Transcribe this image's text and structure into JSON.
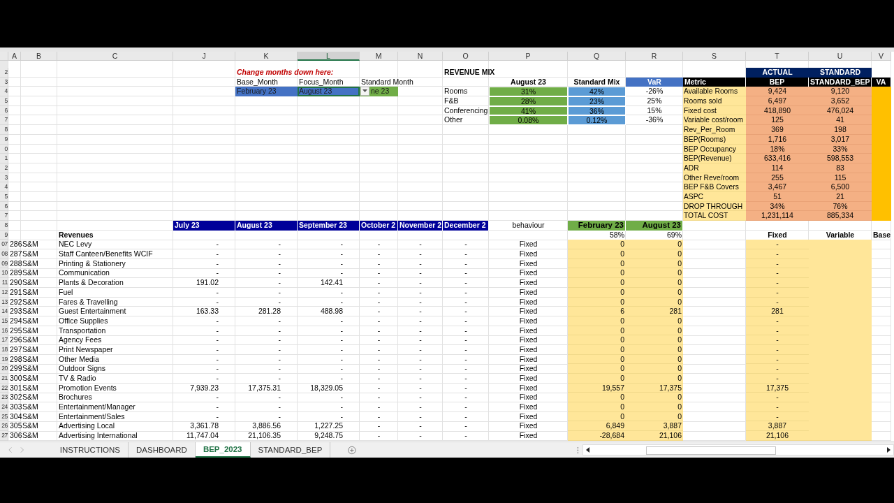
{
  "column_headers": [
    {
      "label": "A",
      "selected": false
    },
    {
      "label": "B",
      "selected": false
    },
    {
      "label": "C",
      "selected": false
    },
    {
      "label": "J",
      "selected": false
    },
    {
      "label": "K",
      "selected": false
    },
    {
      "label": "L",
      "selected": true
    },
    {
      "label": "M",
      "selected": false
    },
    {
      "label": "N",
      "selected": false
    },
    {
      "label": "O",
      "selected": false
    },
    {
      "label": "P",
      "selected": false
    },
    {
      "label": "Q",
      "selected": false
    },
    {
      "label": "R",
      "selected": false
    },
    {
      "label": "S",
      "selected": false
    },
    {
      "label": "T",
      "selected": false
    },
    {
      "label": "U",
      "selected": false
    },
    {
      "label": "V",
      "selected": false
    }
  ],
  "row_headers": [
    "2",
    "3",
    "4",
    "5",
    "6",
    "7",
    "8",
    "9",
    "0",
    "1",
    "2",
    "3",
    "4",
    "5",
    "6",
    "7",
    "8",
    "9",
    "07",
    "08",
    "09",
    "10",
    "11",
    "12",
    "13",
    "14",
    "15",
    "16",
    "17",
    "18",
    "19",
    "20",
    "21",
    "22",
    "23",
    "24",
    "25",
    "26",
    "27"
  ],
  "month_selector": {
    "title": "Change months down here:",
    "fields": [
      {
        "label": "Base_Month",
        "value": "February 23",
        "selected": false,
        "color": "#4472c4"
      },
      {
        "label": "Focus_Month",
        "value": "August 23",
        "selected": true,
        "color": "#4472c4"
      },
      {
        "label": "Standard Month",
        "value": "ne 23",
        "selected": false,
        "color": "#70ad47"
      }
    ]
  },
  "revenue_mix": {
    "title": "REVENUE MIX",
    "columns": [
      "August 23",
      "Standard Mix",
      "VaR"
    ],
    "rows": [
      {
        "label": "Rooms",
        "values": [
          "31%",
          "42%",
          "-26%"
        ]
      },
      {
        "label": "F&B",
        "values": [
          "28%",
          "23%",
          "25%"
        ]
      },
      {
        "label": "Conferencing",
        "values": [
          "41%",
          "36%",
          "15%"
        ]
      },
      {
        "label": "Other",
        "values": [
          "0.08%",
          "0.12%",
          "-36%"
        ]
      }
    ]
  },
  "metrics": {
    "group_headers": [
      "ACTUAL",
      "STANDARD"
    ],
    "columns": [
      "Metric",
      "BEP",
      "STANDARD_BEP",
      "VA"
    ],
    "rows": [
      {
        "label": "Available Rooms",
        "values": [
          "9,424",
          "9,120"
        ]
      },
      {
        "label": "Rooms sold",
        "values": [
          "6,497",
          "3,652"
        ]
      },
      {
        "label": "Fixed cost",
        "values": [
          "418,890",
          "476,024"
        ]
      },
      {
        "label": "Variable cost/room",
        "values": [
          "125",
          "41"
        ]
      },
      {
        "label": "Rev_Per_Room",
        "values": [
          "369",
          "198"
        ]
      },
      {
        "label": "BEP(Rooms)",
        "values": [
          "1,716",
          "3,017"
        ]
      },
      {
        "label": "BEP Occupancy",
        "values": [
          "18%",
          "33%"
        ]
      },
      {
        "label": "BEP(Revenue)",
        "values": [
          "633,416",
          "598,553"
        ]
      },
      {
        "label": "ADR",
        "values": [
          "114",
          "83"
        ]
      },
      {
        "label": "Other Reve/room",
        "values": [
          "255",
          "115"
        ]
      },
      {
        "label": "BEP F&B Covers",
        "values": [
          "3,467",
          "6,500"
        ]
      },
      {
        "label": "ASPC",
        "values": [
          "51",
          "21"
        ]
      },
      {
        "label": "DROP THROUGH",
        "values": [
          "34%",
          "76%"
        ]
      },
      {
        "label": "TOTAL COST",
        "values": [
          "1,231,114",
          "885,334"
        ]
      }
    ]
  },
  "cost_table": {
    "month_columns": [
      "July 23",
      "August 23",
      "September 23",
      "October 2",
      "November 2",
      "December 2"
    ],
    "behaviour_header": "behaviour",
    "compare_columns": [
      "February 23",
      "August 23"
    ],
    "section_label": "Revenues",
    "compare_ratios": [
      "58%",
      "69%"
    ],
    "split_columns": [
      "Fixed",
      "Variable",
      "Base"
    ],
    "rows": [
      {
        "code": "286",
        "dept": "S&M",
        "name": "NEC Levy",
        "months": [
          "-",
          "-",
          "-",
          "-",
          "-",
          "-"
        ],
        "behaviour": "Fixed",
        "compare": [
          "0",
          "0"
        ],
        "fixed": "-"
      },
      {
        "code": "287",
        "dept": "S&M",
        "name": "Staff Canteen/Benefits WCIF",
        "months": [
          "-",
          "-",
          "-",
          "-",
          "-",
          "-"
        ],
        "behaviour": "Fixed",
        "compare": [
          "0",
          "0"
        ],
        "fixed": "-"
      },
      {
        "code": "288",
        "dept": "S&M",
        "name": "Printing & Stationery",
        "months": [
          "-",
          "-",
          "-",
          "-",
          "-",
          "-"
        ],
        "behaviour": "Fixed",
        "compare": [
          "0",
          "0"
        ],
        "fixed": "-"
      },
      {
        "code": "289",
        "dept": "S&M",
        "name": "Communication",
        "months": [
          "-",
          "-",
          "-",
          "-",
          "-",
          "-"
        ],
        "behaviour": "Fixed",
        "compare": [
          "0",
          "0"
        ],
        "fixed": "-"
      },
      {
        "code": "290",
        "dept": "S&M",
        "name": "Plants & Decoration",
        "months": [
          "191.02",
          "-",
          "142.41",
          "-",
          "-",
          "-"
        ],
        "behaviour": "Fixed",
        "compare": [
          "0",
          "0"
        ],
        "fixed": "-"
      },
      {
        "code": "291",
        "dept": "S&M",
        "name": "Fuel",
        "months": [
          "-",
          "-",
          "-",
          "-",
          "-",
          "-"
        ],
        "behaviour": "Fixed",
        "compare": [
          "0",
          "0"
        ],
        "fixed": "-"
      },
      {
        "code": "292",
        "dept": "S&M",
        "name": "Fares & Travelling",
        "months": [
          "-",
          "-",
          "-",
          "-",
          "-",
          "-"
        ],
        "behaviour": "Fixed",
        "compare": [
          "0",
          "0"
        ],
        "fixed": "-"
      },
      {
        "code": "293",
        "dept": "S&M",
        "name": "Guest Entertainment",
        "months": [
          "163.33",
          "281.28",
          "488.98",
          "-",
          "-",
          "-"
        ],
        "behaviour": "Fixed",
        "compare": [
          "6",
          "281"
        ],
        "fixed": "281"
      },
      {
        "code": "294",
        "dept": "S&M",
        "name": "Office Supplies",
        "months": [
          "-",
          "-",
          "-",
          "-",
          "-",
          "-"
        ],
        "behaviour": "Fixed",
        "compare": [
          "0",
          "0"
        ],
        "fixed": "-"
      },
      {
        "code": "295",
        "dept": "S&M",
        "name": "Transportation",
        "months": [
          "-",
          "-",
          "-",
          "-",
          "-",
          "-"
        ],
        "behaviour": "Fixed",
        "compare": [
          "0",
          "0"
        ],
        "fixed": "-"
      },
      {
        "code": "296",
        "dept": "S&M",
        "name": "Agency Fees",
        "months": [
          "-",
          "-",
          "-",
          "-",
          "-",
          "-"
        ],
        "behaviour": "Fixed",
        "compare": [
          "0",
          "0"
        ],
        "fixed": "-"
      },
      {
        "code": "297",
        "dept": "S&M",
        "name": "Print Newspaper",
        "months": [
          "-",
          "-",
          "-",
          "-",
          "-",
          "-"
        ],
        "behaviour": "Fixed",
        "compare": [
          "0",
          "0"
        ],
        "fixed": "-"
      },
      {
        "code": "298",
        "dept": "S&M",
        "name": "Other Media",
        "months": [
          "-",
          "-",
          "-",
          "-",
          "-",
          "-"
        ],
        "behaviour": "Fixed",
        "compare": [
          "0",
          "0"
        ],
        "fixed": "-"
      },
      {
        "code": "299",
        "dept": "S&M",
        "name": "Outdoor Signs",
        "months": [
          "-",
          "-",
          "-",
          "-",
          "-",
          "-"
        ],
        "behaviour": "Fixed",
        "compare": [
          "0",
          "0"
        ],
        "fixed": "-"
      },
      {
        "code": "300",
        "dept": "S&M",
        "name": "TV & Radio",
        "months": [
          "-",
          "-",
          "-",
          "-",
          "-",
          "-"
        ],
        "behaviour": "Fixed",
        "compare": [
          "0",
          "0"
        ],
        "fixed": "-"
      },
      {
        "code": "301",
        "dept": "S&M",
        "name": "Promotion Events",
        "months": [
          "7,939.23",
          "17,375.31",
          "18,329.05",
          "-",
          "-",
          "-"
        ],
        "behaviour": "Fixed",
        "compare": [
          "19,557",
          "17,375"
        ],
        "fixed": "17,375"
      },
      {
        "code": "302",
        "dept": "S&M",
        "name": "Brochures",
        "months": [
          "-",
          "-",
          "-",
          "-",
          "-",
          "-"
        ],
        "behaviour": "Fixed",
        "compare": [
          "0",
          "0"
        ],
        "fixed": "-"
      },
      {
        "code": "303",
        "dept": "S&M",
        "name": "Entertainment/Manager",
        "months": [
          "-",
          "-",
          "-",
          "-",
          "-",
          "-"
        ],
        "behaviour": "Fixed",
        "compare": [
          "0",
          "0"
        ],
        "fixed": "-"
      },
      {
        "code": "304",
        "dept": "S&M",
        "name": "Entertainment/Sales",
        "months": [
          "-",
          "-",
          "-",
          "-",
          "-",
          "-"
        ],
        "behaviour": "Fixed",
        "compare": [
          "0",
          "0"
        ],
        "fixed": "-"
      },
      {
        "code": "305",
        "dept": "S&M",
        "name": "Advertising Local",
        "months": [
          "3,361.78",
          "3,886.56",
          "1,227.25",
          "-",
          "-",
          "-"
        ],
        "behaviour": "Fixed",
        "compare": [
          "6,849",
          "3,887"
        ],
        "fixed": "3,887"
      },
      {
        "code": "306",
        "dept": "S&M",
        "name": "Advertising International",
        "months": [
          "11,747.04",
          "21,106.35",
          "9,248.75",
          "-",
          "-",
          "-"
        ],
        "behaviour": "Fixed",
        "compare": [
          "-28,684",
          "21,106"
        ],
        "fixed": "21,106"
      }
    ]
  },
  "sheet_tabs": [
    {
      "label": "INSTRUCTIONS",
      "selected": false
    },
    {
      "label": "DASHBOARD",
      "selected": false
    },
    {
      "label": "BEP_2023",
      "selected": true
    },
    {
      "label": "STANDARD_BEP",
      "selected": false
    }
  ]
}
